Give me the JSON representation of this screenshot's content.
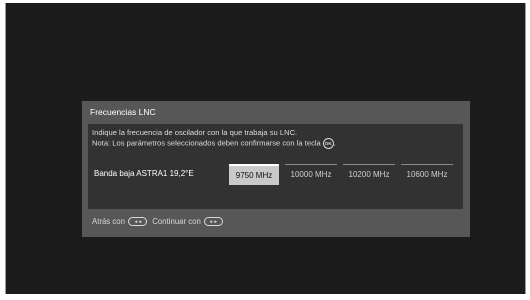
{
  "dialog": {
    "title": "Frecuencias LNC",
    "info_line1": "Indique la frecuencia de oscilador con la que trabaja su LNC.",
    "info_line2": "Nota: Los parámetros seleccionados deben confirmarse con la tecla",
    "ok_icon_label": "OK",
    "band_label": "Banda baja ASTRA1 19,2°E",
    "options": [
      {
        "label": "9750 MHz",
        "selected": true
      },
      {
        "label": "10000 MHz",
        "selected": false
      },
      {
        "label": "10200 MHz",
        "selected": false
      },
      {
        "label": "10600 MHz",
        "selected": false
      }
    ],
    "footer": {
      "back_text": "Atrás con",
      "back_icon": "rewind-button-icon",
      "back_icon_glyph": "◄◄",
      "continue_text": "Continuar con",
      "continue_icon": "fast-forward-button-icon",
      "continue_icon_glyph": "►►"
    }
  },
  "colors": {
    "screen_bg": "#1c1c1c",
    "panel_bg": "#575757",
    "inner_bg": "#323232",
    "selected_bg": "#c9c9c9"
  }
}
